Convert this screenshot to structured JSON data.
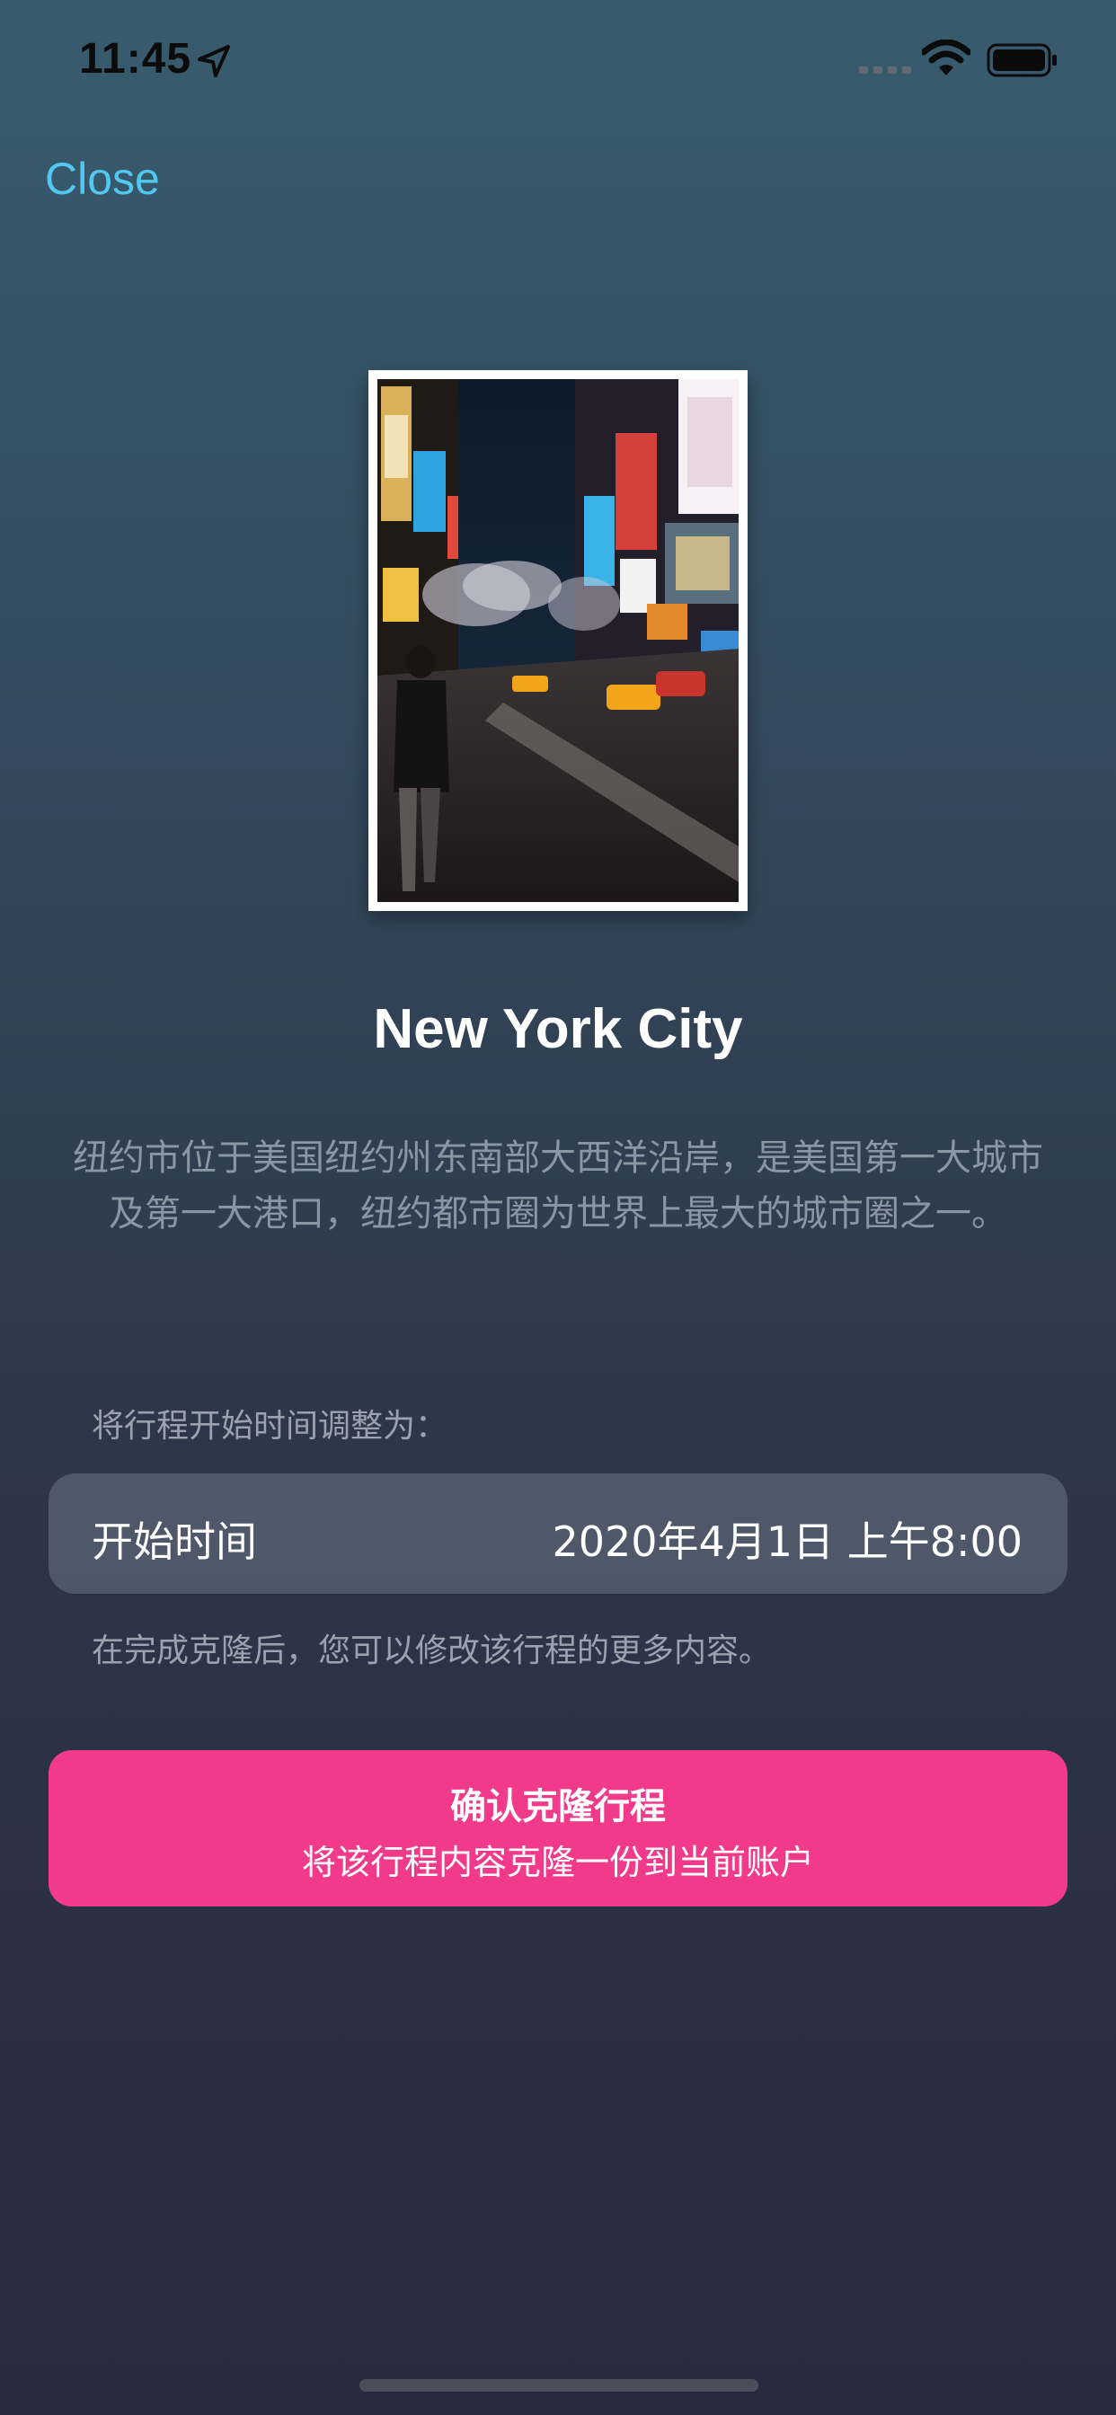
{
  "status_bar": {
    "time": "11:45",
    "icons": [
      "location-arrow-icon",
      "cellular-signal-icon",
      "wifi-icon",
      "battery-icon"
    ]
  },
  "nav": {
    "close_label": "Close"
  },
  "city": {
    "photo_icon": "city-street-photo",
    "title": "New York City",
    "description": "纽约市位于美国纽约州东南部大西洋沿岸，是美国第一大城市及第一大港口，纽约都市圈为世界上最大的城市圈之一。"
  },
  "schedule": {
    "adjust_label": "将行程开始时间调整为：",
    "start_label": "开始时间",
    "start_value": "2020年4月1日 上午8:00",
    "note": "在完成克隆后，您可以修改该行程的更多内容。"
  },
  "confirm": {
    "title": "确认克隆行程",
    "subtitle": "将该行程内容克隆一份到当前账户"
  },
  "colors": {
    "accent_link": "#52c8f0",
    "button_pink": "#f23a8b",
    "bg_top": "#375c6e",
    "bg_bottom": "#292a3e"
  }
}
